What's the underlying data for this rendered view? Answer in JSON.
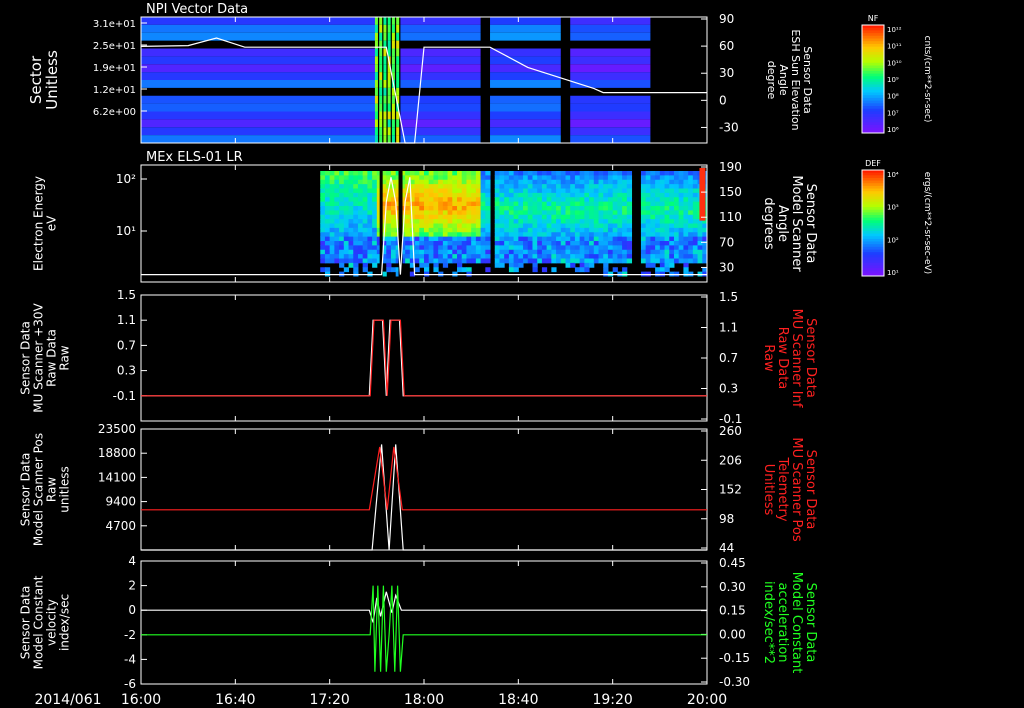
{
  "date_label": "2014/061",
  "time_ticks": [
    "16:00",
    "16:40",
    "17:20",
    "18:00",
    "18:40",
    "19:20",
    "20:00"
  ],
  "colors": {
    "white": "#ffffff",
    "red": "#ff2020",
    "green": "#20ff20",
    "axis": "#ffffff"
  },
  "colorbars": [
    {
      "title": "NF",
      "unit": "cnts/(cm**2-sr-sec)",
      "ticks": [
        "10¹²",
        "10¹¹",
        "10¹⁰",
        "10⁹",
        "10⁸",
        "10⁷",
        "10⁶"
      ]
    },
    {
      "title": "DEF",
      "unit": "ergs/(cm**2-sr-sec-eV)",
      "ticks": [
        "10⁴",
        "10³",
        "10²",
        "10¹"
      ]
    }
  ],
  "chart_data": [
    {
      "type": "heatmap",
      "title": "NPI Vector Data",
      "ylabel": [
        "Sector",
        "Unitless"
      ],
      "yticks": [
        "3.1e+01",
        "2.5e+01",
        "1.9e+01",
        "1.2e+01",
        "6.2e+00"
      ],
      "y2label": [
        "Sensor Data",
        "ESH Sun Elevation",
        "Angle",
        "degree"
      ],
      "y2ticks": [
        "90",
        "60",
        "30",
        "0",
        "-30"
      ],
      "y2lim": [
        -60,
        90
      ],
      "line_series": [
        {
          "color": "white",
          "points": [
            [
              0,
              55
            ],
            [
              5,
              56
            ],
            [
              8,
              65
            ],
            [
              11,
              54
            ],
            [
              26,
              54
            ],
            [
              28,
              -60
            ],
            [
              29,
              -60
            ],
            [
              30,
              54
            ],
            [
              37,
              54
            ],
            [
              41,
              30
            ],
            [
              48,
              5
            ],
            [
              49,
              0
            ],
            [
              60,
              0
            ]
          ]
        }
      ]
    },
    {
      "type": "heatmap",
      "title": "MEx ELS-01 LR",
      "ylabel": [
        "Electron Energy",
        "eV"
      ],
      "yticks": [
        "10²",
        "10¹"
      ],
      "y2label": [
        "Sensor Data",
        "Model Scanner",
        "Angle",
        "degrees"
      ],
      "y2ticks": [
        "190",
        "150",
        "110",
        "70",
        "30"
      ],
      "y2lim": [
        0,
        190
      ],
      "line_series": [
        {
          "color": "white",
          "points": [
            [
              0,
              12
            ],
            [
              25.5,
              12
            ],
            [
              26,
              130
            ],
            [
              26.5,
              170
            ],
            [
              27,
              130
            ],
            [
              27.5,
              12
            ],
            [
              28,
              130
            ],
            [
              28.5,
              170
            ],
            [
              29,
              12
            ],
            [
              60,
              12
            ]
          ]
        }
      ]
    },
    {
      "type": "line",
      "ylabel": [
        "Sensor Data",
        "MU Scanner +30V",
        "Raw Data",
        "Raw"
      ],
      "yticks": [
        "1.5",
        "1.1",
        "0.7",
        "0.3",
        "-0.1"
      ],
      "ylim": [
        -0.5,
        1.5
      ],
      "y2label": [
        "Sensor Data",
        "MU Scanner Inf",
        "Raw Data",
        "Raw"
      ],
      "y2ticks": [
        "1.5",
        "1.1",
        "0.7",
        "0.3",
        "-0.1"
      ],
      "series": [
        {
          "color": "white",
          "points": [
            [
              0,
              -0.1
            ],
            [
              24.2,
              -0.1
            ],
            [
              24.6,
              1.1
            ],
            [
              25.6,
              1.1
            ],
            [
              26.0,
              -0.1
            ],
            [
              26.4,
              1.1
            ],
            [
              27.4,
              1.1
            ],
            [
              27.8,
              -0.1
            ],
            [
              60,
              -0.1
            ]
          ]
        },
        {
          "color": "red",
          "points": [
            [
              0,
              -0.1
            ],
            [
              24.3,
              -0.1
            ],
            [
              24.7,
              1.1
            ],
            [
              25.7,
              1.1
            ],
            [
              26.1,
              -0.1
            ],
            [
              26.5,
              1.1
            ],
            [
              27.5,
              1.1
            ],
            [
              27.9,
              -0.1
            ],
            [
              60,
              -0.1
            ]
          ]
        }
      ]
    },
    {
      "type": "line",
      "ylabel": [
        "Sensor Data",
        "Model Scanner Pos",
        "Raw",
        "unitless"
      ],
      "yticks": [
        "23500",
        "18800",
        "14100",
        "9400",
        "4700"
      ],
      "ylim": [
        0,
        23500
      ],
      "y2label": [
        "Sensor Data",
        "MU Scanner Pos",
        "Telemetry",
        "Unitless"
      ],
      "y2ticks": [
        "260",
        "206",
        "152",
        "98",
        "44"
      ],
      "series": [
        {
          "color": "white",
          "points": [
            [
              0,
              0
            ],
            [
              24.5,
              0
            ],
            [
              25.5,
              20500
            ],
            [
              26.3,
              0
            ],
            [
              27.0,
              20500
            ],
            [
              27.8,
              0
            ],
            [
              60,
              0
            ]
          ]
        },
        {
          "color": "red",
          "points": [
            [
              0,
              7800
            ],
            [
              24.2,
              7800
            ],
            [
              25.3,
              20000
            ],
            [
              26.1,
              7800
            ],
            [
              26.8,
              20000
            ],
            [
              27.7,
              7800
            ],
            [
              60,
              7800
            ]
          ]
        }
      ]
    },
    {
      "type": "line",
      "ylabel": [
        "Sensor Data",
        "Model Constant",
        "velocity",
        "index/sec"
      ],
      "yticks": [
        "4",
        "2",
        "0",
        "-2",
        "-4",
        "-6"
      ],
      "ylim": [
        -6,
        4
      ],
      "y2label": [
        "Sensor Data",
        "Model Constant",
        "acceleration",
        "index/sec**2"
      ],
      "y2ticks": [
        "0.45",
        "0.30",
        "0.15",
        "0.00",
        "-0.15",
        "-0.30"
      ],
      "series": [
        {
          "color": "white",
          "points": [
            [
              0,
              0
            ],
            [
              24.2,
              0
            ],
            [
              24.6,
              -1
            ],
            [
              25.0,
              1
            ],
            [
              25.4,
              -0.5
            ],
            [
              26.0,
              1.5
            ],
            [
              26.6,
              -0.2
            ],
            [
              27.0,
              1.2
            ],
            [
              27.6,
              0
            ],
            [
              60,
              0
            ]
          ]
        },
        {
          "color": "green",
          "points": [
            [
              0,
              -2
            ],
            [
              24.3,
              -2
            ],
            [
              24.6,
              2
            ],
            [
              24.8,
              -5
            ],
            [
              25.1,
              2
            ],
            [
              25.4,
              -5
            ],
            [
              25.7,
              2
            ],
            [
              26.0,
              -5
            ],
            [
              26.3,
              -2
            ],
            [
              26.6,
              2
            ],
            [
              26.9,
              -5
            ],
            [
              27.2,
              2
            ],
            [
              27.5,
              -5
            ],
            [
              27.8,
              -2
            ],
            [
              60,
              -2
            ]
          ]
        }
      ]
    }
  ]
}
